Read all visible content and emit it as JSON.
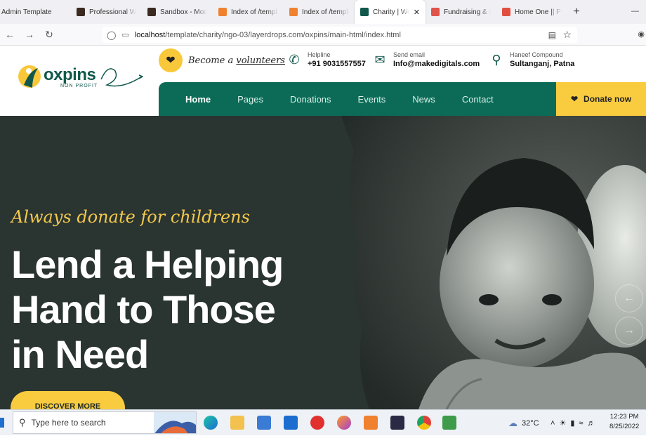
{
  "browser": {
    "tabs": [
      {
        "label": "Admin Template",
        "favicon": "admin-template-favicon",
        "color": "#6b7a90"
      },
      {
        "label": "Professional Web",
        "favicon": "professional-web-favicon",
        "color": "#3b2a1f"
      },
      {
        "label": "Sandbox - Mode",
        "favicon": "sandbox-favicon",
        "color": "#3b2a1f"
      },
      {
        "label": "Index of /templa",
        "favicon": "xampp-favicon",
        "color": "#f0812f"
      },
      {
        "label": "Index of /templa",
        "favicon": "xampp-favicon",
        "color": "#f0812f"
      },
      {
        "label": "Charity | Web",
        "favicon": "oxpins-favicon",
        "color": "#10584b",
        "active": true
      },
      {
        "label": "Fundraising & C",
        "favicon": "fundraising-favicon",
        "color": "#e0534b"
      },
      {
        "label": "Home One || Pifo",
        "favicon": "heart-favicon",
        "color": "#e04f3f"
      }
    ],
    "new_tab_symbol": "+",
    "url_host": "localhost",
    "url_path": "/template/charity/ngo-03/layerdrops.com/oxpins/main-html/index.html"
  },
  "site": {
    "logo_name": "oxpins",
    "logo_subtitle": "NON PROFIT",
    "volunteer_prefix": "Become a ",
    "volunteer_link": "volunteers",
    "contacts": [
      {
        "label": "Helpline",
        "value": "+91 9031557557",
        "icon": "phone-icon"
      },
      {
        "label": "Send email",
        "value": "Info@makedigitals.com",
        "icon": "mail-icon"
      },
      {
        "label": "Haneef Compound",
        "value": "Sultanganj, Patna",
        "icon": "location-pin-icon"
      }
    ],
    "nav": [
      {
        "label": "Home",
        "active": true
      },
      {
        "label": "Pages"
      },
      {
        "label": "Donations"
      },
      {
        "label": "Events"
      },
      {
        "label": "News"
      },
      {
        "label": "Contact"
      }
    ],
    "donate_label": "Donate now",
    "hero": {
      "tagline": "Always donate for childrens",
      "headline_lines": [
        "Lend a Helping",
        "Hand to Those",
        "in Need"
      ],
      "cta": "DISCOVER MORE"
    }
  },
  "taskbar": {
    "search_placeholder": "Type here to search",
    "weather_temp": "32°C",
    "time": "12:23 PM",
    "date": "8/25/2022"
  },
  "colors": {
    "brand_green": "#0c6b57",
    "accent_yellow": "#f9cc3f",
    "hero_bg": "#2a3431"
  }
}
